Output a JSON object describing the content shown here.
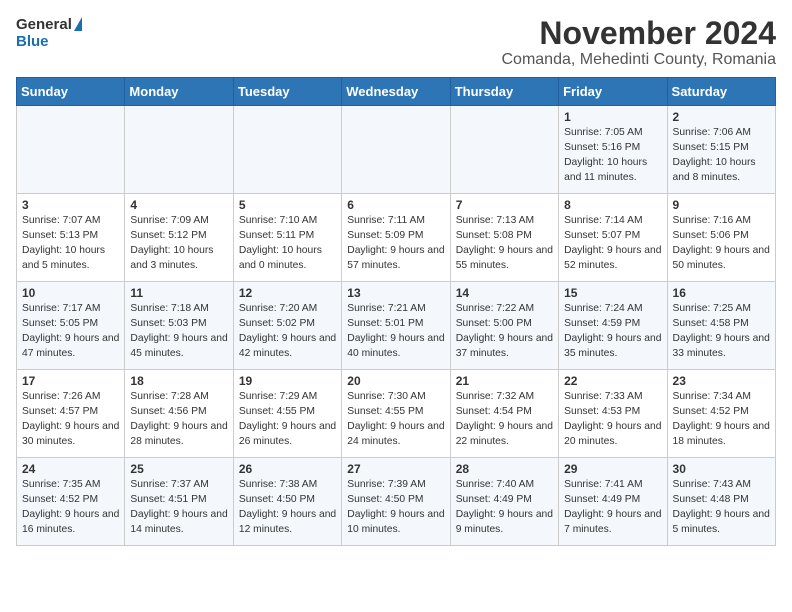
{
  "header": {
    "logo_general": "General",
    "logo_blue": "Blue",
    "month_title": "November 2024",
    "location": "Comanda, Mehedinti County, Romania"
  },
  "days_of_week": [
    "Sunday",
    "Monday",
    "Tuesday",
    "Wednesday",
    "Thursday",
    "Friday",
    "Saturday"
  ],
  "weeks": [
    [
      {
        "day": "",
        "info": ""
      },
      {
        "day": "",
        "info": ""
      },
      {
        "day": "",
        "info": ""
      },
      {
        "day": "",
        "info": ""
      },
      {
        "day": "",
        "info": ""
      },
      {
        "day": "1",
        "info": "Sunrise: 7:05 AM\nSunset: 5:16 PM\nDaylight: 10 hours and 11 minutes."
      },
      {
        "day": "2",
        "info": "Sunrise: 7:06 AM\nSunset: 5:15 PM\nDaylight: 10 hours and 8 minutes."
      }
    ],
    [
      {
        "day": "3",
        "info": "Sunrise: 7:07 AM\nSunset: 5:13 PM\nDaylight: 10 hours and 5 minutes."
      },
      {
        "day": "4",
        "info": "Sunrise: 7:09 AM\nSunset: 5:12 PM\nDaylight: 10 hours and 3 minutes."
      },
      {
        "day": "5",
        "info": "Sunrise: 7:10 AM\nSunset: 5:11 PM\nDaylight: 10 hours and 0 minutes."
      },
      {
        "day": "6",
        "info": "Sunrise: 7:11 AM\nSunset: 5:09 PM\nDaylight: 9 hours and 57 minutes."
      },
      {
        "day": "7",
        "info": "Sunrise: 7:13 AM\nSunset: 5:08 PM\nDaylight: 9 hours and 55 minutes."
      },
      {
        "day": "8",
        "info": "Sunrise: 7:14 AM\nSunset: 5:07 PM\nDaylight: 9 hours and 52 minutes."
      },
      {
        "day": "9",
        "info": "Sunrise: 7:16 AM\nSunset: 5:06 PM\nDaylight: 9 hours and 50 minutes."
      }
    ],
    [
      {
        "day": "10",
        "info": "Sunrise: 7:17 AM\nSunset: 5:05 PM\nDaylight: 9 hours and 47 minutes."
      },
      {
        "day": "11",
        "info": "Sunrise: 7:18 AM\nSunset: 5:03 PM\nDaylight: 9 hours and 45 minutes."
      },
      {
        "day": "12",
        "info": "Sunrise: 7:20 AM\nSunset: 5:02 PM\nDaylight: 9 hours and 42 minutes."
      },
      {
        "day": "13",
        "info": "Sunrise: 7:21 AM\nSunset: 5:01 PM\nDaylight: 9 hours and 40 minutes."
      },
      {
        "day": "14",
        "info": "Sunrise: 7:22 AM\nSunset: 5:00 PM\nDaylight: 9 hours and 37 minutes."
      },
      {
        "day": "15",
        "info": "Sunrise: 7:24 AM\nSunset: 4:59 PM\nDaylight: 9 hours and 35 minutes."
      },
      {
        "day": "16",
        "info": "Sunrise: 7:25 AM\nSunset: 4:58 PM\nDaylight: 9 hours and 33 minutes."
      }
    ],
    [
      {
        "day": "17",
        "info": "Sunrise: 7:26 AM\nSunset: 4:57 PM\nDaylight: 9 hours and 30 minutes."
      },
      {
        "day": "18",
        "info": "Sunrise: 7:28 AM\nSunset: 4:56 PM\nDaylight: 9 hours and 28 minutes."
      },
      {
        "day": "19",
        "info": "Sunrise: 7:29 AM\nSunset: 4:55 PM\nDaylight: 9 hours and 26 minutes."
      },
      {
        "day": "20",
        "info": "Sunrise: 7:30 AM\nSunset: 4:55 PM\nDaylight: 9 hours and 24 minutes."
      },
      {
        "day": "21",
        "info": "Sunrise: 7:32 AM\nSunset: 4:54 PM\nDaylight: 9 hours and 22 minutes."
      },
      {
        "day": "22",
        "info": "Sunrise: 7:33 AM\nSunset: 4:53 PM\nDaylight: 9 hours and 20 minutes."
      },
      {
        "day": "23",
        "info": "Sunrise: 7:34 AM\nSunset: 4:52 PM\nDaylight: 9 hours and 18 minutes."
      }
    ],
    [
      {
        "day": "24",
        "info": "Sunrise: 7:35 AM\nSunset: 4:52 PM\nDaylight: 9 hours and 16 minutes."
      },
      {
        "day": "25",
        "info": "Sunrise: 7:37 AM\nSunset: 4:51 PM\nDaylight: 9 hours and 14 minutes."
      },
      {
        "day": "26",
        "info": "Sunrise: 7:38 AM\nSunset: 4:50 PM\nDaylight: 9 hours and 12 minutes."
      },
      {
        "day": "27",
        "info": "Sunrise: 7:39 AM\nSunset: 4:50 PM\nDaylight: 9 hours and 10 minutes."
      },
      {
        "day": "28",
        "info": "Sunrise: 7:40 AM\nSunset: 4:49 PM\nDaylight: 9 hours and 9 minutes."
      },
      {
        "day": "29",
        "info": "Sunrise: 7:41 AM\nSunset: 4:49 PM\nDaylight: 9 hours and 7 minutes."
      },
      {
        "day": "30",
        "info": "Sunrise: 7:43 AM\nSunset: 4:48 PM\nDaylight: 9 hours and 5 minutes."
      }
    ]
  ]
}
